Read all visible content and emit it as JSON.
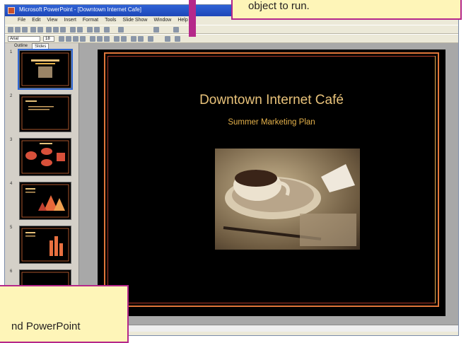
{
  "window": {
    "title": "Microsoft PowerPoint - [Downtown Internet Cafe]",
    "menu": [
      "File",
      "Edit",
      "View",
      "Insert",
      "Format",
      "Tools",
      "Slide Show",
      "Window",
      "Help"
    ],
    "font_name": "Arial",
    "font_size": "18"
  },
  "left_panel": {
    "tabs": [
      "Outline",
      "Slides"
    ],
    "slide_numbers": [
      "1",
      "2",
      "3",
      "4",
      "5",
      "6"
    ]
  },
  "slide": {
    "title": "Downtown Internet Café",
    "subtitle": "Summer Marketing Plan",
    "background_color": "#000000",
    "title_color": "#e8c27a",
    "subtitle_color": "#e3b04a",
    "frame_colors": [
      "#e0763a",
      "#b03a28",
      "#f0b050"
    ]
  },
  "callouts": {
    "top_text": "object to run.",
    "bottom_text": "nd PowerPoint",
    "border_color": "#b5288a",
    "fill_color": "#fef5b8"
  }
}
